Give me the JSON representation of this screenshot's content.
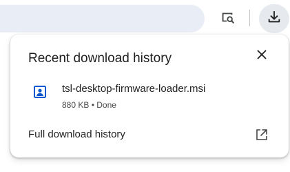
{
  "toolbar": {
    "icons": {
      "lens": "search-in-page-icon",
      "downloads": "download-icon"
    }
  },
  "download_bubble": {
    "title": "Recent download history",
    "close_icon": "close-icon",
    "items": [
      {
        "file_name": "tsl-desktop-firmware-loader.msi",
        "status": "880 KB • Done",
        "icon": "installer-file-icon"
      }
    ],
    "full_history_label": "Full download history",
    "full_history_icon": "open-in-new-icon"
  },
  "colors": {
    "accent": "#0b57d0",
    "omnibox_bg": "#e9eef6",
    "download_button_bg": "#e6e9ee",
    "text_primary": "#1f1f1f",
    "text_secondary": "#474747",
    "icon_gray": "#444746"
  }
}
